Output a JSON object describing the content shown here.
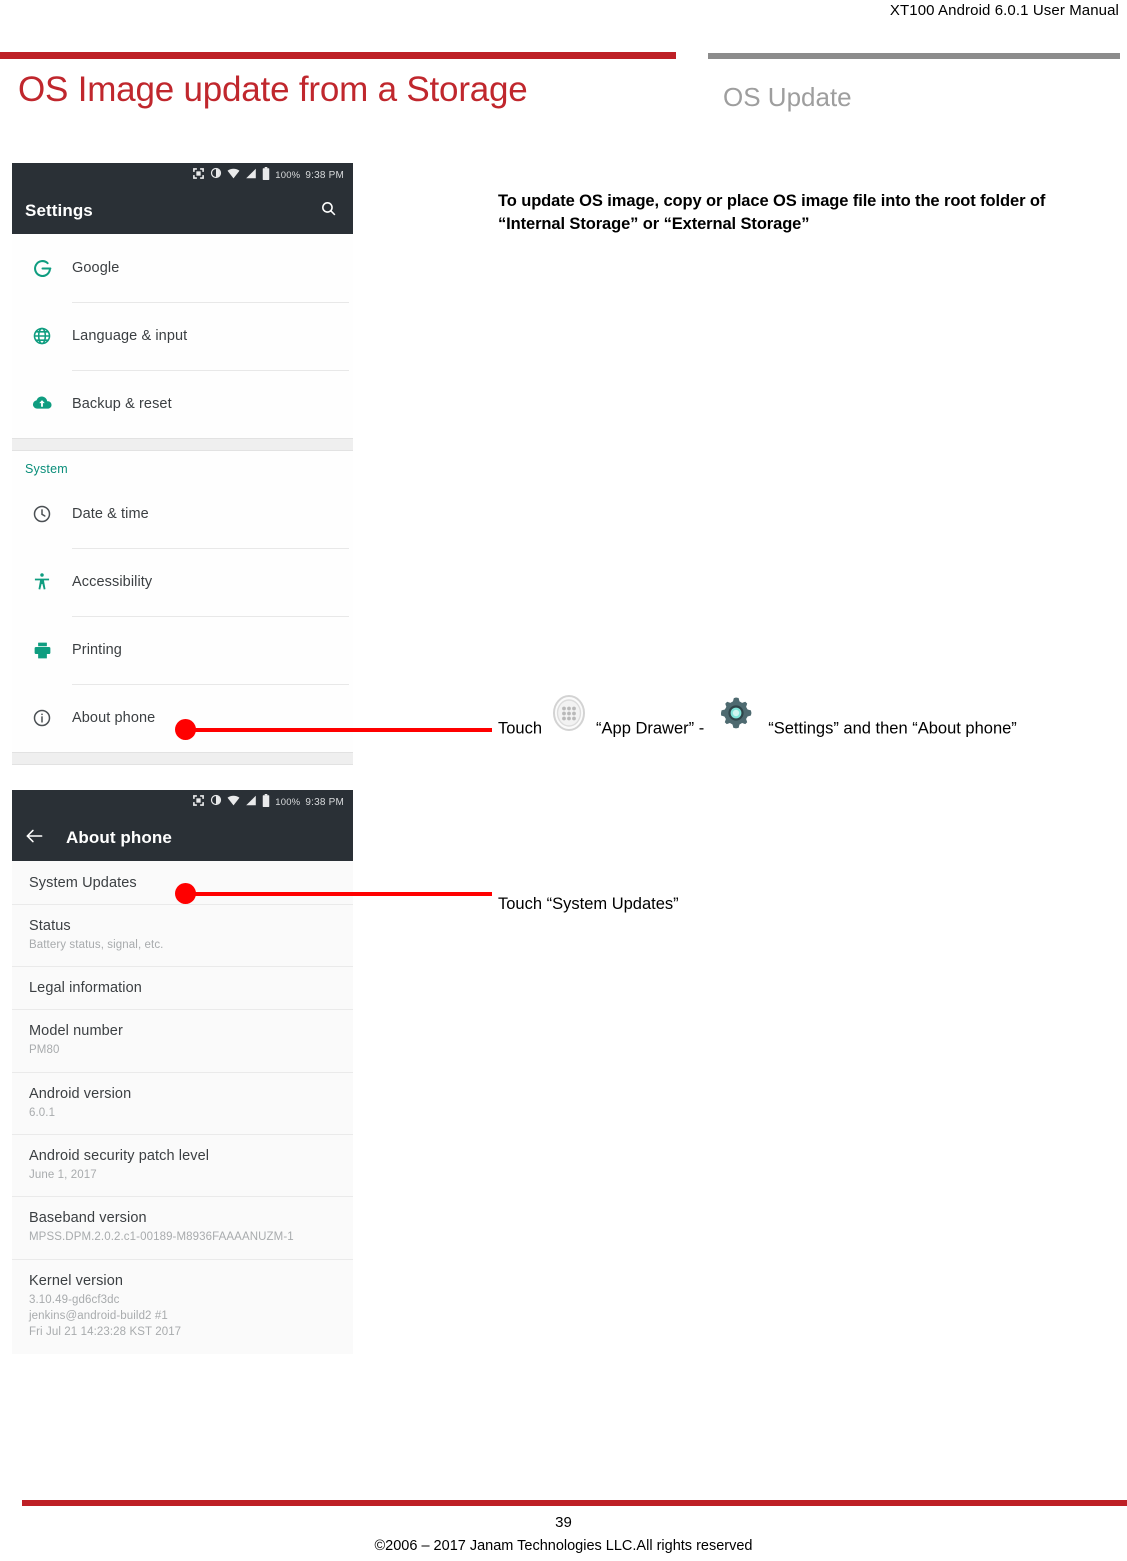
{
  "document": {
    "header": "XT100 Android 6.0.1 User Manual",
    "title": "OS Image update from a Storage",
    "section_label": "OS Update",
    "page_number": "39",
    "copyright": "©2006 – 2017 Janam Technologies LLC.All rights reserved",
    "accent_red": "#BE2026",
    "title_red": "#C0272D",
    "section_gray": "#9E9E9E",
    "callout_red": "#FF0000"
  },
  "instructions": {
    "note": "To update OS image, copy or place OS image file into the root folder of “Internal Storage” or “External Storage”",
    "step_drawer_pre": "Touch",
    "step_drawer_mid": "“App Drawer” -",
    "step_drawer_post": "“Settings” and then “About phone”",
    "step_system_updates": "Touch “System Updates”",
    "drawer_icon": "app-drawer-icon",
    "settings_icon": "gear-icon"
  },
  "screenshot_settings": {
    "statusbar": {
      "icons": [
        "scan-icon",
        "brightness-icon",
        "wifi-icon",
        "signal-icon",
        "battery-icon"
      ],
      "battery_percent": "100%",
      "time": "9:38 PM"
    },
    "appbar": {
      "title": "Settings",
      "search_icon": "search-icon"
    },
    "items": [
      {
        "label": "Google",
        "icon": "google-g-icon"
      },
      {
        "label": "Language & input",
        "icon": "globe-icon"
      },
      {
        "label": "Backup & reset",
        "icon": "cloud-upload-icon"
      }
    ],
    "group_header": "System",
    "system_items": [
      {
        "label": "Date & time",
        "icon": "clock-icon"
      },
      {
        "label": "Accessibility",
        "icon": "accessibility-icon"
      },
      {
        "label": "Printing",
        "icon": "printer-icon"
      },
      {
        "label": "About phone",
        "icon": "info-icon"
      }
    ]
  },
  "screenshot_about": {
    "statusbar": {
      "icons": [
        "scan-icon",
        "brightness-icon",
        "wifi-icon",
        "signal-icon",
        "battery-icon"
      ],
      "battery_percent": "100%",
      "time": "9:38 PM"
    },
    "appbar": {
      "back_icon": "arrow-back-icon",
      "title": "About phone"
    },
    "rows": [
      {
        "title": "System Updates",
        "sub": ""
      },
      {
        "title": "Status",
        "sub": "Battery status, signal, etc."
      },
      {
        "title": "Legal information",
        "sub": ""
      },
      {
        "title": "Model number",
        "sub": "PM80"
      },
      {
        "title": "Android version",
        "sub": "6.0.1"
      },
      {
        "title": "Android security patch level",
        "sub": "June 1, 2017"
      },
      {
        "title": "Baseband version",
        "sub": "MPSS.DPM.2.0.2.c1-00189-M8936FAAAANUZM-1"
      },
      {
        "title": "Kernel version",
        "sub": "3.10.49-gd6cf3dc\njenkins@android-build2 #1\nFri Jul 21 14:23:28 KST 2017"
      }
    ]
  }
}
